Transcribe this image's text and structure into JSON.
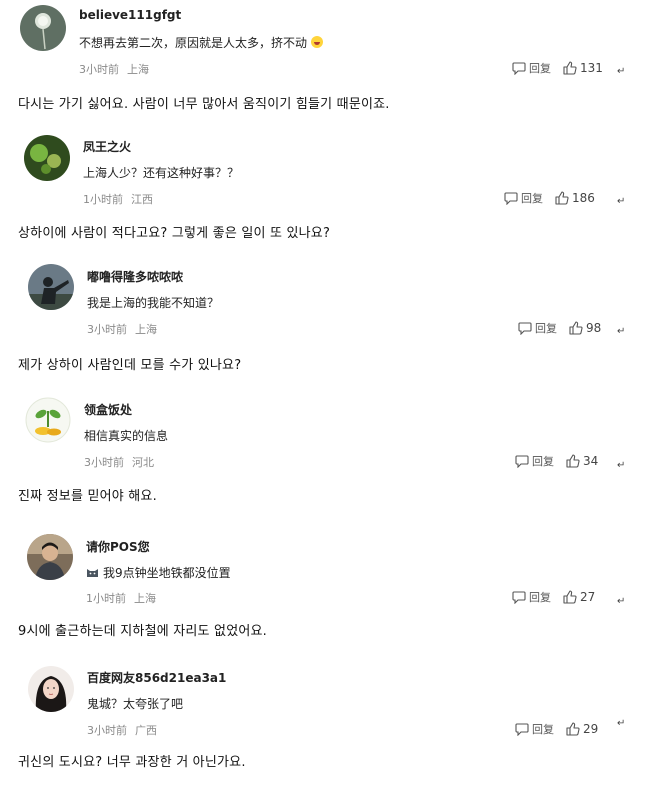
{
  "colors": {
    "meta_gray": "#8a8a8a",
    "text": "#222222"
  },
  "comments": [
    {
      "username": "believe111gfgt",
      "text": "不想再去第二次，原因就是人太多，挤不动",
      "emoji": "grinning-face",
      "time": "3小时前",
      "location": "上海",
      "reply_label": "回复",
      "likes": "131",
      "avatar": "dandelion-avatar",
      "translation": "다시는 가기 싫어요. 사람이 너무 많아서 움직이기 힘들기 때문이죠."
    },
    {
      "username": "凤王之火",
      "text": "上海人少？还有这种好事？？",
      "time": "1小时前",
      "location": "江西",
      "reply_label": "回复",
      "likes": "186",
      "avatar": "green-light-avatar",
      "translation": "상하이에 사람이 적다고요? 그렇게 좋은 일이 또 있나요?"
    },
    {
      "username": "嘟噜得隆多哝哝哝",
      "text": "我是上海的我能不知道？",
      "time": "3小时前",
      "location": "上海",
      "reply_label": "回复",
      "likes": "98",
      "avatar": "silhouette-avatar",
      "translation": "제가 상하이 사람인데 모를 수가 있나요?"
    },
    {
      "username": "领盒饭处",
      "text": "相信真实的信息",
      "time": "3小时前",
      "location": "河北",
      "reply_label": "回复",
      "likes": "34",
      "avatar": "sprout-coin-avatar",
      "translation": "진짜 정보를 믿어야 해요."
    },
    {
      "username": "请你POS您",
      "text": "我9点钟坐地铁都没位置",
      "time": "1小时前",
      "location": "上海",
      "reply_label": "回复",
      "likes": "27",
      "avatar": "man-photo-avatar",
      "translation": "9시에 출근하는데 지하철에 자리도 없었어요."
    },
    {
      "username": "百度网友856d21ea3a1",
      "text": "鬼城？太夸张了吧",
      "time": "3小时前",
      "location": "广西",
      "reply_label": "回复",
      "likes": "29",
      "avatar": "woman-photo-avatar",
      "translation": "귀신의 도시요? 너무 과장한 거 아닌가요."
    }
  ],
  "para_mark": "↵"
}
